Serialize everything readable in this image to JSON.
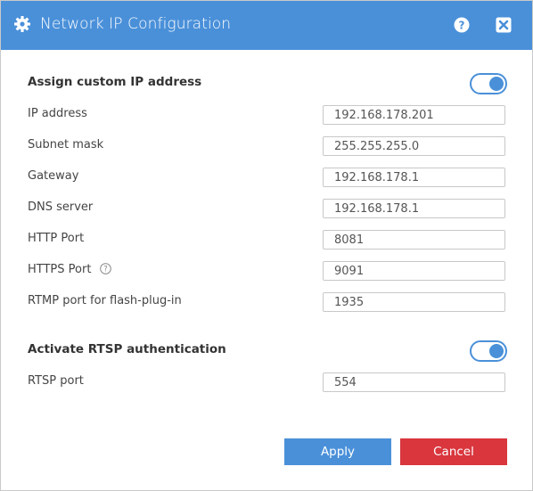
{
  "dialog": {
    "title": "Network IP Configuration"
  },
  "custom_ip": {
    "label": "Assign custom IP address",
    "enabled": true
  },
  "fields": {
    "ip_address": {
      "label": "IP address",
      "value": "192.168.178.201"
    },
    "subnet_mask": {
      "label": "Subnet mask",
      "value": "255.255.255.0"
    },
    "gateway": {
      "label": "Gateway",
      "value": "192.168.178.1"
    },
    "dns_server": {
      "label": "DNS server",
      "value": "192.168.178.1"
    },
    "http_port": {
      "label": "HTTP Port",
      "value": "8081"
    },
    "https_port": {
      "label": "HTTPS Port",
      "value": "9091"
    },
    "rtmp_port": {
      "label": "RTMP port for flash-plug-in",
      "value": "1935"
    }
  },
  "rtsp": {
    "label": "Activate RTSP authentication",
    "enabled": true,
    "port_label": "RTSP port",
    "port_value": "554"
  },
  "buttons": {
    "apply": "Apply",
    "cancel": "Cancel"
  },
  "colors": {
    "accent": "#4a90d9",
    "danger": "#d9363e"
  },
  "icons": [
    "gear-icon",
    "help-icon",
    "close-icon",
    "info-icon"
  ]
}
